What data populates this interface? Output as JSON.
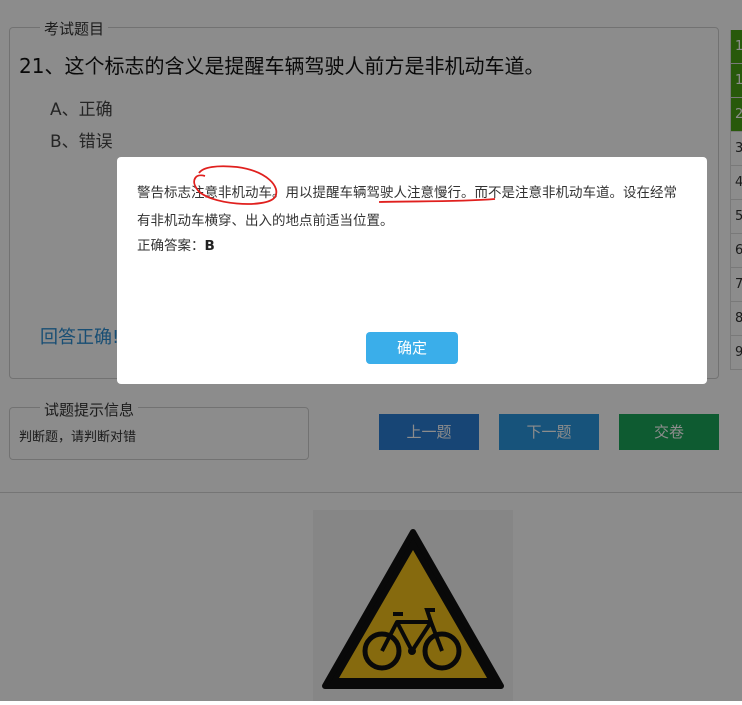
{
  "question_panel": {
    "legend": "考试题目",
    "question": "21、这个标志的含义是提醒车辆驾驶人前方是非机动车道。",
    "options": [
      "A、正确",
      "B、错误"
    ],
    "result_text": "回答正确!"
  },
  "answer_card": {
    "items": [
      "1",
      "1",
      "2",
      "3",
      "4",
      "5",
      "6",
      "7",
      "8",
      "9"
    ]
  },
  "hint": {
    "legend": "试题提示信息",
    "text": "判断题，请判断对错"
  },
  "buttons": {
    "prev": "上一题",
    "next": "下一题",
    "submit": "交卷"
  },
  "modal": {
    "explanation": "警告标志注意非机动车。用以提醒车辆驾驶人注意慢行。而不是注意非机动车道。设在经常有非机动车横穿、出入的地点前适当位置。",
    "answer_label": "正确答案：",
    "answer_value": "B",
    "ok_label": "确定"
  },
  "colors": {
    "prev_button": "#2b7ed6",
    "next_button": "#2a97e0",
    "submit_button": "#1ba65a",
    "card_done": "#4aa314",
    "ok_button": "#3aaeea",
    "annotation_ink": "#e0201e"
  }
}
